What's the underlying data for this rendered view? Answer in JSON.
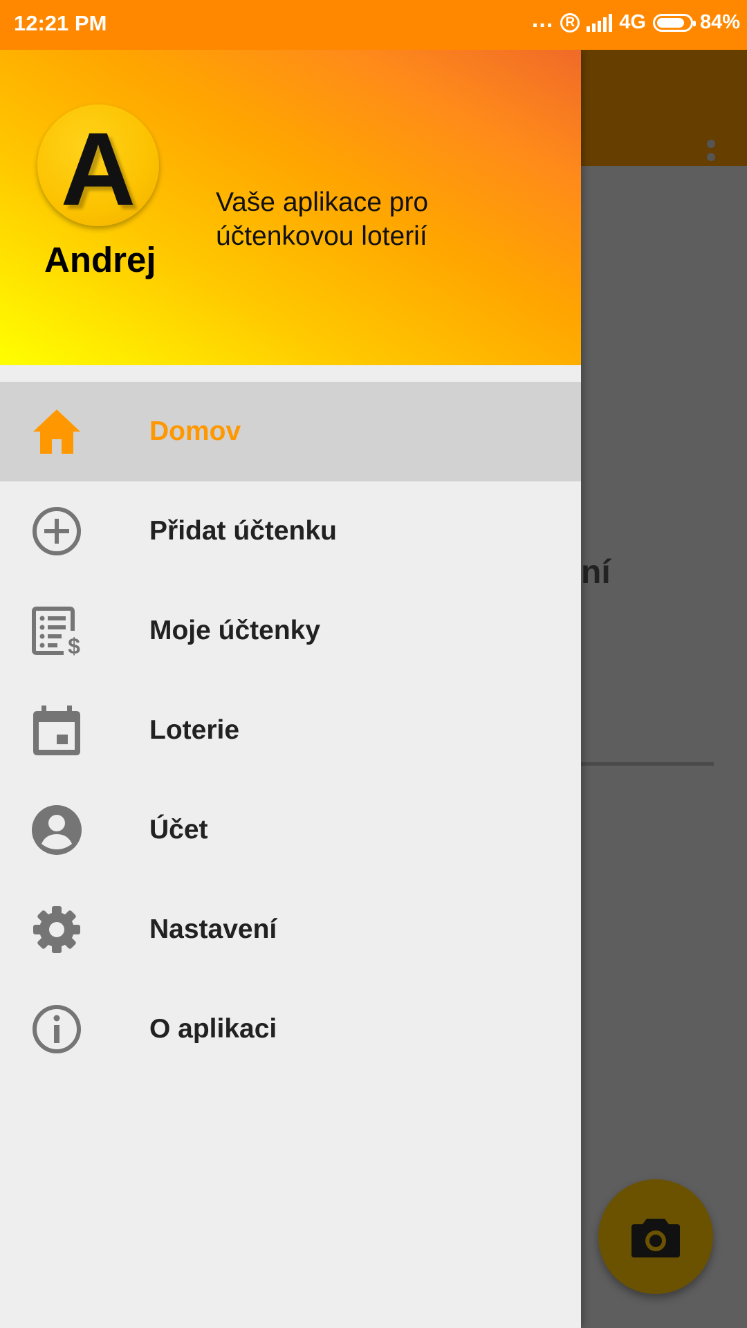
{
  "status_bar": {
    "time": "12:21 PM",
    "dots": "...",
    "registered_mark": "R",
    "network": "4G",
    "battery": "84%",
    "battery_level": 0.84
  },
  "colors": {
    "status_bar": "#ff8800",
    "accent": "#ff9800",
    "active_item_bg": "#d2d2d2",
    "drawer_bg": "#eeeeee",
    "icon_grey": "#757575"
  },
  "drawer": {
    "header": {
      "avatar_letter": "A",
      "user_name": "Andrej",
      "tagline": "Vaše aplikace pro účtenkovou loterií"
    },
    "items": [
      {
        "label": "Domov",
        "icon": "home-icon",
        "active": true
      },
      {
        "label": "Přidat účtenku",
        "icon": "add-circle-icon",
        "active": false
      },
      {
        "label": "Moje účtenky",
        "icon": "receipt-list-icon",
        "active": false
      },
      {
        "label": "Loterie",
        "icon": "calendar-icon",
        "active": false
      },
      {
        "label": "Účet",
        "icon": "account-icon",
        "active": false
      },
      {
        "label": "Nastavení",
        "icon": "gear-icon",
        "active": false
      },
      {
        "label": "O aplikaci",
        "icon": "info-icon",
        "active": false
      }
    ]
  },
  "background": {
    "partial_text": "ní",
    "fab_icon": "camera-icon",
    "toolbar_icon": "more-vert-icon"
  }
}
